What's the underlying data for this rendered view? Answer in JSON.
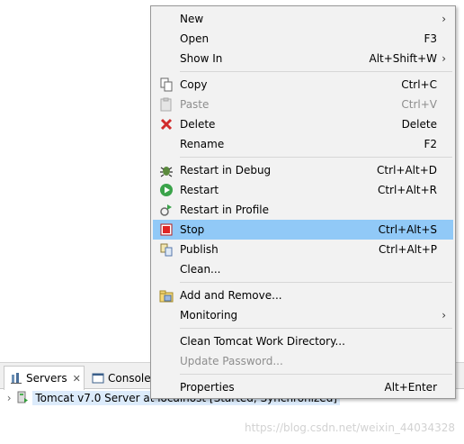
{
  "menu": {
    "groups": [
      [
        {
          "label": "New",
          "shortcut": "",
          "submenu": true,
          "icon": "none"
        },
        {
          "label": "Open",
          "shortcut": "F3",
          "submenu": false,
          "icon": "none"
        },
        {
          "label": "Show In",
          "shortcut": "Alt+Shift+W",
          "submenu": true,
          "icon": "none"
        }
      ],
      [
        {
          "label": "Copy",
          "shortcut": "Ctrl+C",
          "icon": "copy-icon"
        },
        {
          "label": "Paste",
          "shortcut": "Ctrl+V",
          "icon": "paste-icon",
          "disabled": true
        },
        {
          "label": "Delete",
          "shortcut": "Delete",
          "icon": "delete-icon"
        },
        {
          "label": "Rename",
          "shortcut": "F2",
          "icon": "none"
        }
      ],
      [
        {
          "label": "Restart in Debug",
          "shortcut": "Ctrl+Alt+D",
          "icon": "debug-bug-icon"
        },
        {
          "label": "Restart",
          "shortcut": "Ctrl+Alt+R",
          "icon": "run-icon"
        },
        {
          "label": "Restart in Profile",
          "shortcut": "",
          "icon": "profile-icon"
        },
        {
          "label": "Stop",
          "shortcut": "Ctrl+Alt+S",
          "icon": "stop-icon",
          "highlighted": true
        },
        {
          "label": "Publish",
          "shortcut": "Ctrl+Alt+P",
          "icon": "publish-icon"
        },
        {
          "label": "Clean...",
          "shortcut": "",
          "icon": "none"
        }
      ],
      [
        {
          "label": "Add and Remove...",
          "shortcut": "",
          "icon": "add-remove-icon"
        },
        {
          "label": "Monitoring",
          "shortcut": "",
          "submenu": true,
          "icon": "none"
        }
      ],
      [
        {
          "label": "Clean Tomcat Work Directory...",
          "shortcut": "",
          "icon": "none"
        },
        {
          "label": "Update Password...",
          "shortcut": "",
          "icon": "none",
          "disabled": true
        }
      ],
      [
        {
          "label": "Properties",
          "shortcut": "Alt+Enter",
          "icon": "none"
        }
      ]
    ]
  },
  "view": {
    "tabs": [
      {
        "label": "Servers",
        "icon": "servers-icon",
        "active": true,
        "closable": true
      },
      {
        "label": "Console",
        "icon": "console-icon",
        "active": false
      }
    ],
    "server_entry": "Tomcat v7.0 Server at localhost  [Started, Synchronized]",
    "watermark": "https://blog.csdn.net/weixin_44034328"
  },
  "colors": {
    "highlight": "#91c9f7",
    "menu_bg": "#f2f2f2",
    "selection": "#dcebfb"
  }
}
